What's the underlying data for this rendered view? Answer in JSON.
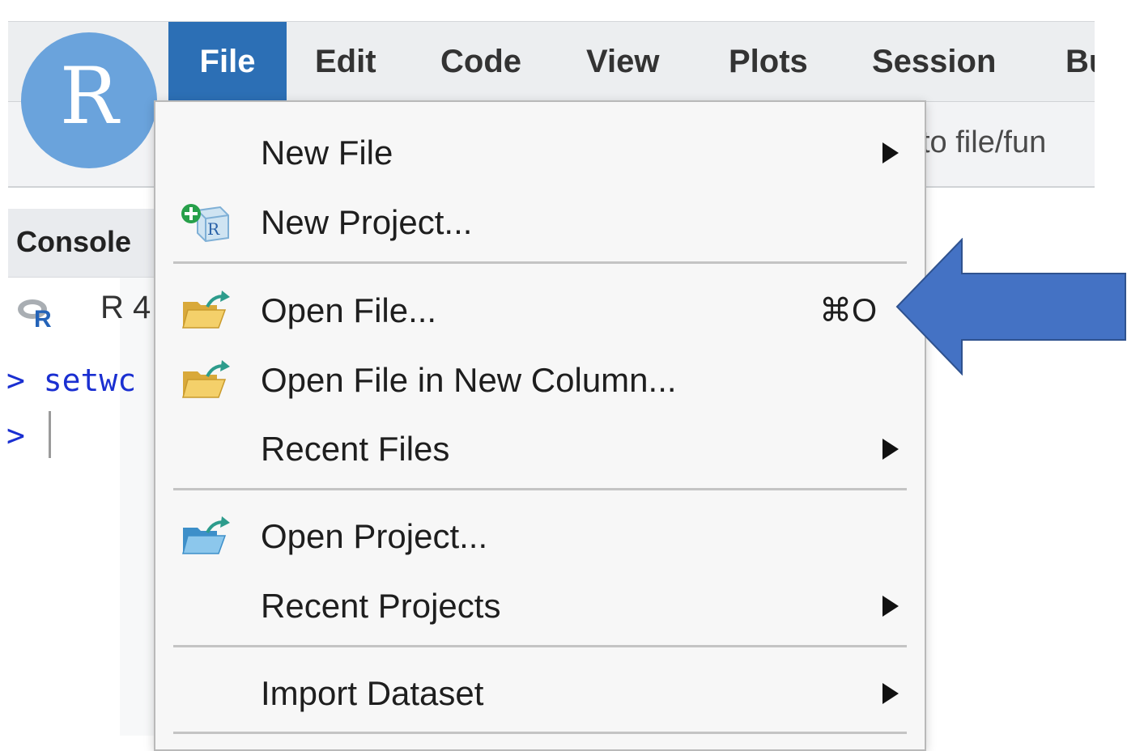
{
  "app": {
    "logo_letter": "R"
  },
  "menubar": {
    "items": [
      {
        "label": "File"
      },
      {
        "label": "Edit"
      },
      {
        "label": "Code"
      },
      {
        "label": "View"
      },
      {
        "label": "Plots"
      },
      {
        "label": "Session"
      },
      {
        "label": "Bu"
      }
    ],
    "active": "File"
  },
  "toolbar": {
    "goto_value": "to file/fun"
  },
  "console": {
    "title": "Console",
    "version_text": "R 4",
    "line1": "> setwc",
    "line2": ">"
  },
  "file_menu": {
    "items": [
      {
        "label": "New File",
        "icon": "none",
        "submenu": true
      },
      {
        "label": "New Project...",
        "icon": "new-project-icon"
      },
      {
        "label": "Open File...",
        "icon": "open-folder-icon",
        "shortcut": "⌘O"
      },
      {
        "label": "Open File in New Column...",
        "icon": "open-folder-icon"
      },
      {
        "label": "Recent Files",
        "icon": "none",
        "submenu": true
      },
      {
        "label": "Open Project...",
        "icon": "open-project-icon"
      },
      {
        "label": "Recent Projects",
        "icon": "none",
        "submenu": true
      },
      {
        "label": "Import Dataset",
        "icon": "none",
        "submenu": true
      }
    ]
  },
  "colors": {
    "active_menu": "#2c6fb5",
    "annotation_arrow": "#4472c4",
    "logo": "#6aa3dc",
    "console_text": "#1a2fd1"
  }
}
